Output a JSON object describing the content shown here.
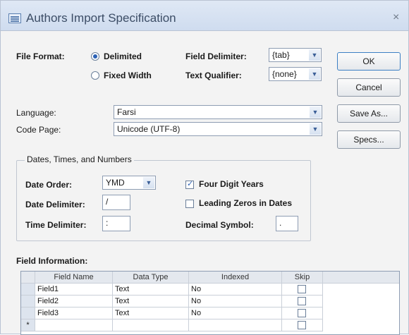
{
  "window": {
    "title": "Authors Import Specification",
    "close_glyph": "×"
  },
  "file_format": {
    "label": "File Format:",
    "options": [
      "Delimited",
      "Fixed Width"
    ],
    "selected": "Delimited"
  },
  "field_delimiter": {
    "label": "Field Delimiter:",
    "value": "{tab}"
  },
  "text_qualifier": {
    "label": "Text Qualifier:",
    "value": "{none}"
  },
  "buttons": {
    "ok": "OK",
    "cancel": "Cancel",
    "save_as": "Save As...",
    "specs": "Specs..."
  },
  "language": {
    "label": "Language:",
    "value": "Farsi"
  },
  "code_page": {
    "label": "Code Page:",
    "value": "Unicode (UTF-8)"
  },
  "dates_group": {
    "title": "Dates, Times, and Numbers",
    "date_order": {
      "label": "Date Order:",
      "value": "YMD"
    },
    "date_delimiter": {
      "label": "Date Delimiter:",
      "value": "/"
    },
    "time_delimiter": {
      "label": "Time Delimiter:",
      "value": ":"
    },
    "four_digit_years": {
      "label": "Four Digit Years",
      "checked": true
    },
    "leading_zeros": {
      "label": "Leading Zeros in Dates",
      "checked": false
    },
    "decimal_symbol": {
      "label": "Decimal Symbol:",
      "value": "."
    }
  },
  "field_information": {
    "label": "Field Information:",
    "columns": [
      "Field Name",
      "Data Type",
      "Indexed",
      "Skip"
    ],
    "rows": [
      {
        "field_name": "Field1",
        "data_type": "Text",
        "indexed": "No",
        "skip": false
      },
      {
        "field_name": "Field2",
        "data_type": "Text",
        "indexed": "No",
        "skip": false
      },
      {
        "field_name": "Field3",
        "data_type": "Text",
        "indexed": "No",
        "skip": false
      }
    ],
    "new_row_marker": "*"
  },
  "colors": {
    "accent": "#2c62b5",
    "title_bar": "#d6e2f2"
  }
}
